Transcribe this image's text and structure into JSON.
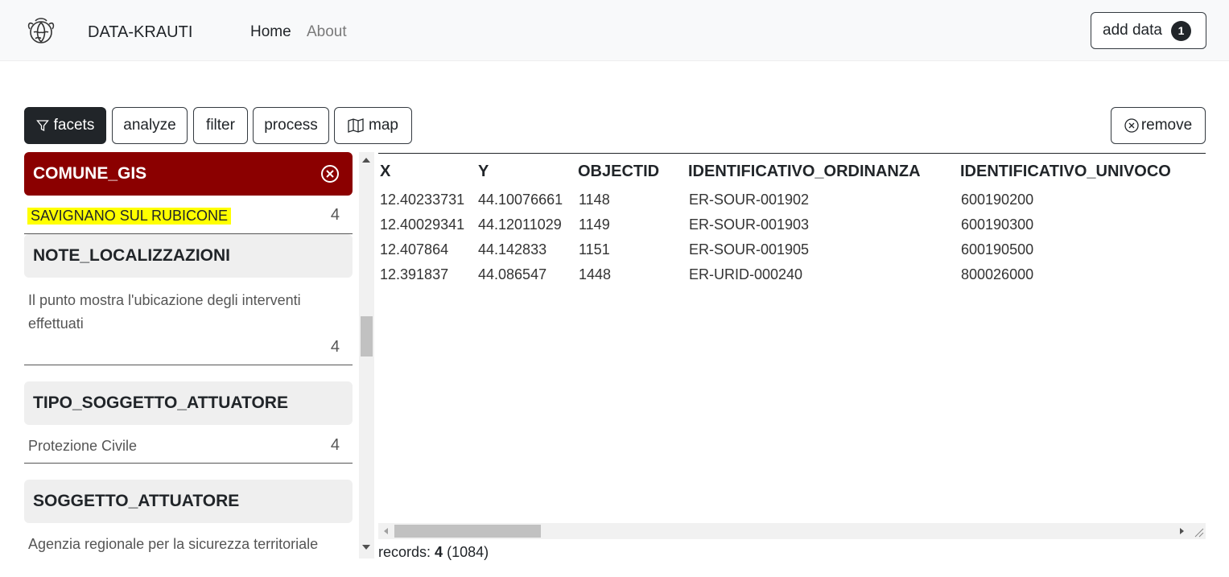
{
  "navbar": {
    "brand": "DATA-KRAUTI",
    "links": [
      {
        "label": "Home",
        "active": true
      },
      {
        "label": "About",
        "active": false
      }
    ],
    "add_data": {
      "label": "add data",
      "badge": "1"
    }
  },
  "toolbar": {
    "facets": "facets",
    "analyze": "analyze",
    "filter": "filter",
    "process": "process",
    "map": "map",
    "remove": "remove"
  },
  "facets": [
    {
      "name": "COMUNE_GIS",
      "selected": true,
      "values": [
        {
          "label": "SAVIGNANO SUL RUBICONE",
          "count": "4",
          "highlighted": true
        }
      ]
    },
    {
      "name": "NOTE_LOCALIZZAZIONI",
      "selected": false,
      "values": [
        {
          "label": "Il punto mostra l'ubicazione degli interventi effettuati",
          "count": "4"
        }
      ]
    },
    {
      "name": "TIPO_SOGGETTO_ATTUATORE",
      "selected": false,
      "values": [
        {
          "label": "Protezione Civile",
          "count": "4"
        }
      ]
    },
    {
      "name": "SOGGETTO_ATTUATORE",
      "selected": false,
      "values": [
        {
          "label": "Agenzia regionale per la sicurezza territoriale",
          "count": ""
        }
      ]
    }
  ],
  "table": {
    "columns": [
      "X",
      "Y",
      "OBJECTID",
      "IDENTIFICATIVO_ORDINANZA",
      "IDENTIFICATIVO_UNIVOCO"
    ],
    "rows": [
      [
        "12.40233731",
        "44.10076661",
        "1148",
        "ER-SOUR-001902",
        "600190200"
      ],
      [
        "12.40029341",
        "44.12011029",
        "1149",
        "ER-SOUR-001903",
        "600190300"
      ],
      [
        "12.407864",
        "44.142833",
        "1151",
        "ER-SOUR-001905",
        "600190500"
      ],
      [
        "12.391837",
        "44.086547",
        "1448",
        "ER-URID-000240",
        "800026000"
      ]
    ]
  },
  "records": {
    "label": "records:",
    "count": "4",
    "total": "(1084)"
  },
  "colors": {
    "selected_facet": "#8b0000",
    "highlight": "#ffff00",
    "dark": "#212529"
  }
}
